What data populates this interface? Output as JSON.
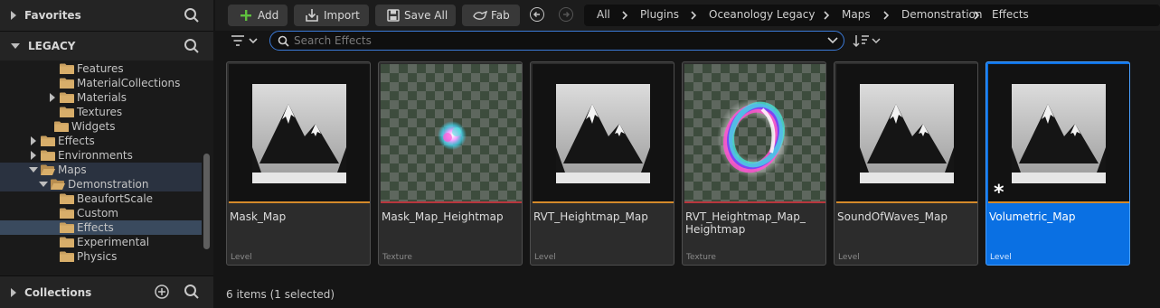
{
  "sidebar": {
    "favorites_label": "Favorites",
    "legacy_label": "LEGACY",
    "collections_label": "Collections",
    "tree": [
      {
        "label": "Features",
        "indent": 4,
        "arrow": "none"
      },
      {
        "label": "MaterialCollections",
        "indent": 4,
        "arrow": "none"
      },
      {
        "label": "Materials",
        "indent": 4,
        "arrow": "right"
      },
      {
        "label": "Textures",
        "indent": 4,
        "arrow": "none"
      },
      {
        "label": "Widgets",
        "indent": 3,
        "arrow": "none"
      },
      {
        "label": "Effects",
        "indent": 2,
        "arrow": "right"
      },
      {
        "label": "Environments",
        "indent": 2,
        "arrow": "right"
      },
      {
        "label": "Maps",
        "indent": 2,
        "arrow": "down",
        "state": "highlight"
      },
      {
        "label": "Demonstration",
        "indent": 3,
        "arrow": "down",
        "state": "highlight",
        "open": true
      },
      {
        "label": "BeaufortScale",
        "indent": 4,
        "arrow": "none"
      },
      {
        "label": "Custom",
        "indent": 4,
        "arrow": "none"
      },
      {
        "label": "Effects",
        "indent": 4,
        "arrow": "none",
        "state": "selected"
      },
      {
        "label": "Experimental",
        "indent": 4,
        "arrow": "none"
      },
      {
        "label": "Physics",
        "indent": 4,
        "arrow": "none"
      }
    ]
  },
  "toolbar": {
    "add_label": "Add",
    "import_label": "Import",
    "save_all_label": "Save All",
    "fab_label": "Fab"
  },
  "breadcrumb": [
    "All",
    "Plugins",
    "Oceanology Legacy",
    "Maps",
    "Demonstration",
    "Effects"
  ],
  "search": {
    "placeholder": "Search Effects",
    "value": ""
  },
  "assets": [
    {
      "name": "Mask_Map",
      "type": "Level",
      "thumb": "mountain",
      "bar_color": "#d48a2a"
    },
    {
      "name": "Mask_Map_Heightmap",
      "type": "Texture",
      "thumb": "sphere",
      "bar_color": "#b8363d"
    },
    {
      "name": "RVT_Heightmap_Map",
      "type": "Level",
      "thumb": "mountain",
      "bar_color": "#d48a2a"
    },
    {
      "name": "RVT_Heightmap_Map_\nHeightmap",
      "type": "Texture",
      "thumb": "ring",
      "bar_color": "#b8363d"
    },
    {
      "name": "SoundOfWaves_Map",
      "type": "Level",
      "thumb": "mountain",
      "bar_color": "#d48a2a"
    },
    {
      "name": "Volumetric_Map",
      "type": "Level",
      "thumb": "mountain",
      "bar_color": "#d48a2a",
      "selected": true,
      "unsaved": "*"
    }
  ],
  "status": "6 items (1 selected)",
  "colors": {
    "accent": "#0a70e3",
    "level_bar": "#d48a2a",
    "texture_bar": "#b8363d",
    "folder": "#c9a060"
  }
}
